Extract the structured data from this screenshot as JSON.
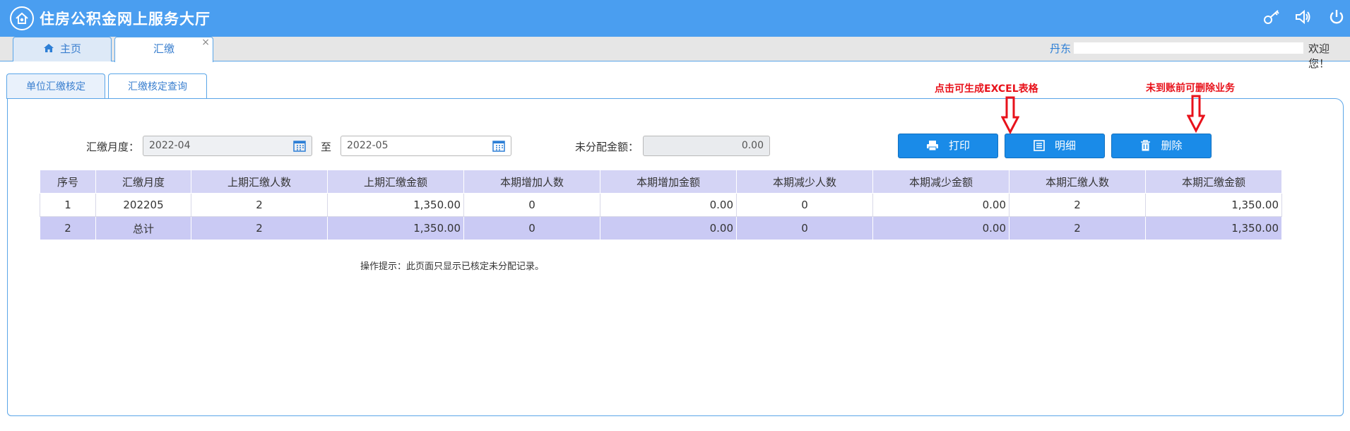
{
  "header": {
    "title": "住房公积金网上服务大厅",
    "icons": [
      "home-logo-icon",
      "key-icon",
      "speaker-icon",
      "power-icon"
    ]
  },
  "top_tabs": [
    {
      "label": "主页",
      "icon": "home-icon"
    },
    {
      "label": "汇缴",
      "close": "×"
    }
  ],
  "user": {
    "name": "丹东",
    "welcome": "欢迎您！"
  },
  "sub_tabs": [
    {
      "label": "单位汇缴核定"
    },
    {
      "label": "汇缴核定查询"
    }
  ],
  "form": {
    "month_label": "汇缴月度：",
    "from": "2022-04",
    "to_label": "至",
    "to": "2022-05",
    "unallocated_label": "未分配金额：",
    "unallocated_value": "0.00"
  },
  "buttons": {
    "print": "打印",
    "detail": "明细",
    "delete": "删除"
  },
  "annotations": {
    "excel": "点击可生成EXCEL表格",
    "delete": "未到账前可删除业务"
  },
  "table": {
    "headers": [
      "序号",
      "汇缴月度",
      "上期汇缴人数",
      "上期汇缴金额",
      "本期增加人数",
      "本期增加金额",
      "本期减少人数",
      "本期减少金额",
      "本期汇缴人数",
      "本期汇缴金额"
    ],
    "rows": [
      [
        "1",
        "202205",
        "2",
        "1,350.00",
        "0",
        "0.00",
        "0",
        "0.00",
        "2",
        "1,350.00"
      ],
      [
        "2",
        "总计",
        "2",
        "1,350.00",
        "0",
        "0.00",
        "0",
        "0.00",
        "2",
        "1,350.00"
      ]
    ]
  },
  "hint": "操作提示：此页面只显示已核定未分配记录。",
  "colors": {
    "header_bg": "#4a9ef0",
    "button_bg": "#1a8be8",
    "table_header": "#d4d4f5",
    "total_row": "#cacaf4",
    "annotation": "#e8121b"
  }
}
